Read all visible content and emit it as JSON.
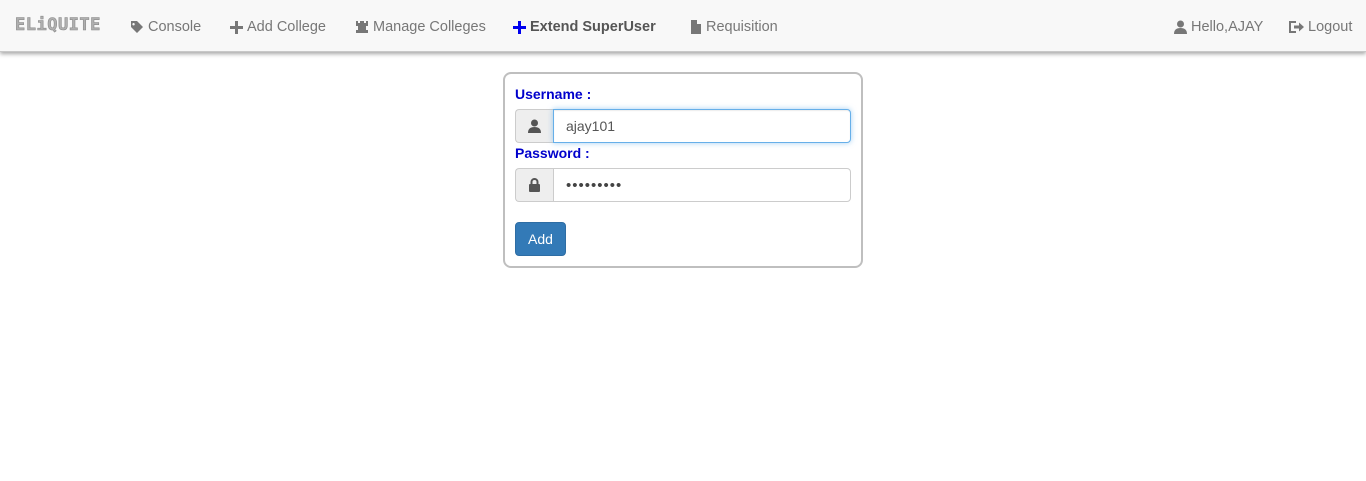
{
  "navbar": {
    "brand": "ELiQUITE",
    "items": [
      {
        "label": "Console",
        "icon": "tag-icon"
      },
      {
        "label": "Add College",
        "icon": "plus-icon"
      },
      {
        "label": "Manage Colleges",
        "icon": "tower-icon"
      },
      {
        "label": "Extend SuperUser",
        "icon": "plus-icon",
        "active": true
      },
      {
        "label": "Requisition",
        "icon": "file-icon"
      }
    ],
    "user_greeting": "Hello,AJAY",
    "logout_label": "Logout"
  },
  "form": {
    "username_label": "Username :",
    "username_value": "ajay101",
    "password_label": "Password :",
    "password_value": "•••••••••",
    "submit_label": "Add"
  },
  "colors": {
    "accent": "#337ab7",
    "label_blue": "#0000cc",
    "active_icon": "#0000ee",
    "navbar_bg": "#f8f8f8"
  }
}
